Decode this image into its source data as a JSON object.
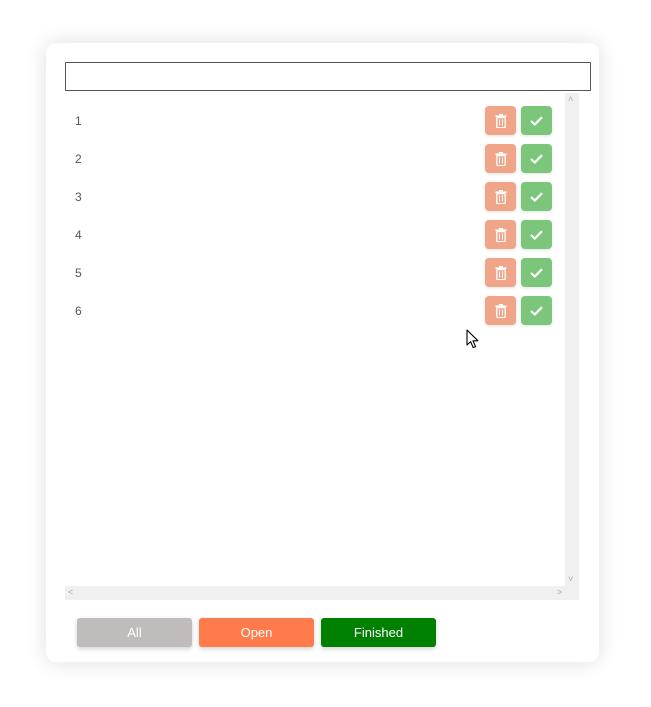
{
  "input": {
    "value": "",
    "placeholder": ""
  },
  "todos": [
    {
      "label": "1"
    },
    {
      "label": "2"
    },
    {
      "label": "3"
    },
    {
      "label": "4"
    },
    {
      "label": "5"
    },
    {
      "label": "6"
    }
  ],
  "item_actions": {
    "delete_icon": "trash-icon",
    "complete_icon": "check-icon"
  },
  "filters": {
    "all": "All",
    "open": "Open",
    "finished": "Finished"
  },
  "colors": {
    "delete": "#f0a488",
    "complete": "#7cc67c",
    "filter_all": "#c1bcbc",
    "filter_open": "#ff7b4b",
    "filter_finished": "#008000"
  }
}
